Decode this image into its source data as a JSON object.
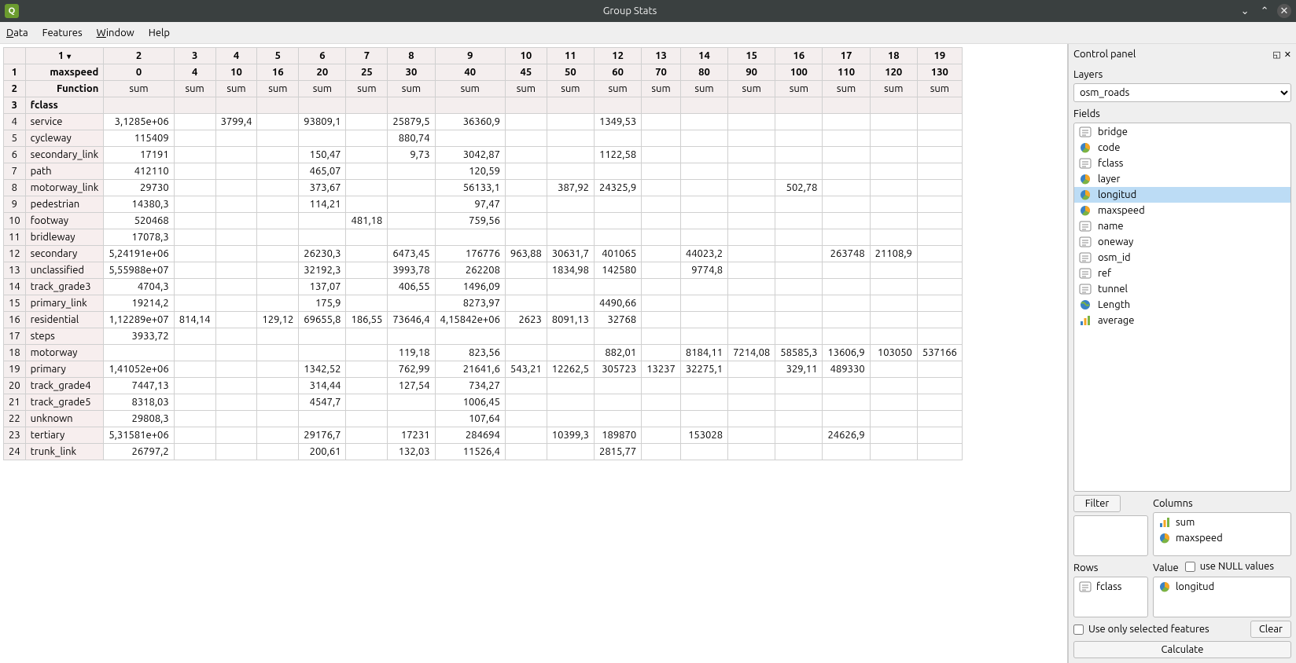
{
  "window": {
    "title": "Group Stats"
  },
  "menubar": [
    {
      "label": "Data",
      "u": "D"
    },
    {
      "label": "Features",
      "u": ""
    },
    {
      "label": "Window",
      "u": "W"
    },
    {
      "label": "Help",
      "u": ""
    }
  ],
  "table": {
    "colHeaders": [
      "1",
      "2",
      "3",
      "4",
      "5",
      "6",
      "7",
      "8",
      "9",
      "10",
      "11",
      "12",
      "13",
      "14",
      "15",
      "16",
      "17",
      "18",
      "19"
    ],
    "row1_label": "maxspeed",
    "row1_vals": [
      "0",
      "4",
      "10",
      "16",
      "20",
      "25",
      "30",
      "40",
      "45",
      "50",
      "60",
      "70",
      "80",
      "90",
      "100",
      "110",
      "120",
      "130"
    ],
    "row2_label": "Function",
    "row2_vals": [
      "sum",
      "sum",
      "sum",
      "sum",
      "sum",
      "sum",
      "sum",
      "sum",
      "sum",
      "sum",
      "sum",
      "sum",
      "sum",
      "sum",
      "sum",
      "sum",
      "sum",
      "sum"
    ],
    "row3_label": "fclass",
    "rows": [
      {
        "n": "4",
        "label": "service",
        "c": [
          "3,1285e+06",
          "",
          "3799,4",
          "",
          "93809,1",
          "",
          "25879,5",
          "36360,9",
          "",
          "",
          "1349,53",
          "",
          "",
          "",
          "",
          "",
          "",
          ""
        ]
      },
      {
        "n": "5",
        "label": "cycleway",
        "c": [
          "115409",
          "",
          "",
          "",
          "",
          "",
          "880,74",
          "",
          "",
          "",
          "",
          "",
          "",
          "",
          "",
          "",
          "",
          ""
        ]
      },
      {
        "n": "6",
        "label": "secondary_link",
        "c": [
          "17191",
          "",
          "",
          "",
          "150,47",
          "",
          "9,73",
          "3042,87",
          "",
          "",
          "1122,58",
          "",
          "",
          "",
          "",
          "",
          "",
          ""
        ]
      },
      {
        "n": "7",
        "label": "path",
        "c": [
          "412110",
          "",
          "",
          "",
          "465,07",
          "",
          "",
          "120,59",
          "",
          "",
          "",
          "",
          "",
          "",
          "",
          "",
          "",
          ""
        ]
      },
      {
        "n": "8",
        "label": "motorway_link",
        "c": [
          "29730",
          "",
          "",
          "",
          "373,67",
          "",
          "",
          "56133,1",
          "",
          "387,92",
          "24325,9",
          "",
          "",
          "",
          "502,78",
          "",
          "",
          ""
        ]
      },
      {
        "n": "9",
        "label": "pedestrian",
        "c": [
          "14380,3",
          "",
          "",
          "",
          "114,21",
          "",
          "",
          "97,47",
          "",
          "",
          "",
          "",
          "",
          "",
          "",
          "",
          "",
          ""
        ]
      },
      {
        "n": "10",
        "label": "footway",
        "c": [
          "520468",
          "",
          "",
          "",
          "",
          "481,18",
          "",
          "759,56",
          "",
          "",
          "",
          "",
          "",
          "",
          "",
          "",
          "",
          ""
        ]
      },
      {
        "n": "11",
        "label": "bridleway",
        "c": [
          "17078,3",
          "",
          "",
          "",
          "",
          "",
          "",
          "",
          "",
          "",
          "",
          "",
          "",
          "",
          "",
          "",
          "",
          ""
        ]
      },
      {
        "n": "12",
        "label": "secondary",
        "c": [
          "5,24191e+06",
          "",
          "",
          "",
          "26230,3",
          "",
          "6473,45",
          "176776",
          "963,88",
          "30631,7",
          "401065",
          "",
          "44023,2",
          "",
          "",
          "263748",
          "21108,9",
          ""
        ]
      },
      {
        "n": "13",
        "label": "unclassified",
        "c": [
          "5,55988e+07",
          "",
          "",
          "",
          "32192,3",
          "",
          "3993,78",
          "262208",
          "",
          "1834,98",
          "142580",
          "",
          "9774,8",
          "",
          "",
          "",
          "",
          ""
        ]
      },
      {
        "n": "14",
        "label": "track_grade3",
        "c": [
          "4704,3",
          "",
          "",
          "",
          "137,07",
          "",
          "406,55",
          "1496,09",
          "",
          "",
          "",
          "",
          "",
          "",
          "",
          "",
          "",
          ""
        ]
      },
      {
        "n": "15",
        "label": "primary_link",
        "c": [
          "19214,2",
          "",
          "",
          "",
          "175,9",
          "",
          "",
          "8273,97",
          "",
          "",
          "4490,66",
          "",
          "",
          "",
          "",
          "",
          "",
          ""
        ]
      },
      {
        "n": "16",
        "label": "residential",
        "c": [
          "1,12289e+07",
          "814,14",
          "",
          "129,12",
          "69655,8",
          "186,55",
          "73646,4",
          "4,15842e+06",
          "2623",
          "8091,13",
          "32768",
          "",
          "",
          "",
          "",
          "",
          "",
          ""
        ]
      },
      {
        "n": "17",
        "label": "steps",
        "c": [
          "3933,72",
          "",
          "",
          "",
          "",
          "",
          "",
          "",
          "",
          "",
          "",
          "",
          "",
          "",
          "",
          "",
          "",
          ""
        ]
      },
      {
        "n": "18",
        "label": "motorway",
        "c": [
          "",
          "",
          "",
          "",
          "",
          "",
          "119,18",
          "823,56",
          "",
          "",
          "882,01",
          "",
          "8184,11",
          "7214,08",
          "58585,3",
          "13606,9",
          "103050",
          "537166"
        ]
      },
      {
        "n": "19",
        "label": "primary",
        "c": [
          "1,41052e+06",
          "",
          "",
          "",
          "1342,52",
          "",
          "762,99",
          "21641,6",
          "543,21",
          "12262,5",
          "305723",
          "13237",
          "32275,1",
          "",
          "329,11",
          "489330",
          "",
          ""
        ]
      },
      {
        "n": "20",
        "label": "track_grade4",
        "c": [
          "7447,13",
          "",
          "",
          "",
          "314,44",
          "",
          "127,54",
          "734,27",
          "",
          "",
          "",
          "",
          "",
          "",
          "",
          "",
          "",
          ""
        ]
      },
      {
        "n": "21",
        "label": "track_grade5",
        "c": [
          "8318,03",
          "",
          "",
          "",
          "4547,7",
          "",
          "",
          "1006,45",
          "",
          "",
          "",
          "",
          "",
          "",
          "",
          "",
          "",
          ""
        ]
      },
      {
        "n": "22",
        "label": "unknown",
        "c": [
          "29808,3",
          "",
          "",
          "",
          "",
          "",
          "",
          "107,64",
          "",
          "",
          "",
          "",
          "",
          "",
          "",
          "",
          "",
          ""
        ]
      },
      {
        "n": "23",
        "label": "tertiary",
        "c": [
          "5,31581e+06",
          "",
          "",
          "",
          "29176,7",
          "",
          "17231",
          "284694",
          "",
          "10399,3",
          "189870",
          "",
          "153028",
          "",
          "",
          "24626,9",
          "",
          ""
        ]
      },
      {
        "n": "24",
        "label": "trunk_link",
        "c": [
          "26797,2",
          "",
          "",
          "",
          "200,61",
          "",
          "132,03",
          "11526,4",
          "",
          "",
          "2815,77",
          "",
          "",
          "",
          "",
          "",
          "",
          ""
        ]
      }
    ]
  },
  "panel": {
    "title": "Control panel",
    "layers_label": "Layers",
    "layer_selected": "osm_roads",
    "fields_label": "Fields",
    "fields": [
      {
        "name": "bridge",
        "icon": "text"
      },
      {
        "name": "code",
        "icon": "pie"
      },
      {
        "name": "fclass",
        "icon": "text"
      },
      {
        "name": "layer",
        "icon": "pie"
      },
      {
        "name": "longitud",
        "icon": "pie",
        "selected": true
      },
      {
        "name": "maxspeed",
        "icon": "pie"
      },
      {
        "name": "name",
        "icon": "text"
      },
      {
        "name": "oneway",
        "icon": "text"
      },
      {
        "name": "osm_id",
        "icon": "text"
      },
      {
        "name": "ref",
        "icon": "text"
      },
      {
        "name": "tunnel",
        "icon": "text"
      },
      {
        "name": "Length",
        "icon": "globe"
      },
      {
        "name": "average",
        "icon": "bar"
      }
    ],
    "filter_label": "Filter",
    "columns_label": "Columns",
    "columns_items": [
      {
        "name": "sum",
        "icon": "bar"
      },
      {
        "name": "maxspeed",
        "icon": "pie"
      }
    ],
    "rows_label": "Rows",
    "rows_items": [
      {
        "name": "fclass",
        "icon": "text"
      }
    ],
    "value_label": "Value",
    "use_null": "use NULL values",
    "value_items": [
      {
        "name": "longitud",
        "icon": "pie"
      }
    ],
    "use_selected": "Use only selected features",
    "clear_label": "Clear",
    "calculate_label": "Calculate"
  }
}
